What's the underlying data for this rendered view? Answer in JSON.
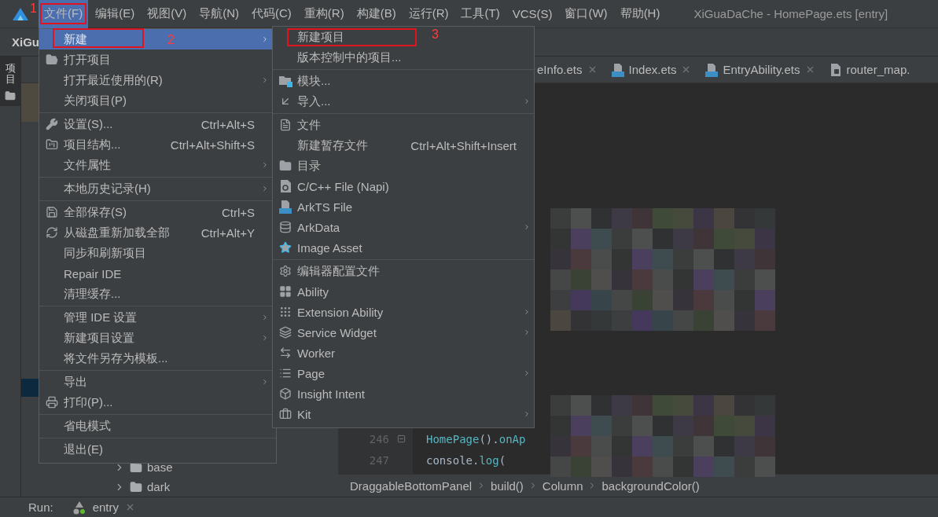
{
  "menubar": {
    "items": [
      {
        "label": "文件(F)",
        "selected": true
      },
      {
        "label": "编辑(E)",
        "selected": false
      },
      {
        "label": "视图(V)",
        "selected": false
      },
      {
        "label": "导航(N)",
        "selected": false
      },
      {
        "label": "代码(C)",
        "selected": false
      },
      {
        "label": "重构(R)",
        "selected": false
      },
      {
        "label": "构建(B)",
        "selected": false
      },
      {
        "label": "运行(R)",
        "selected": false
      },
      {
        "label": "工具(T)",
        "selected": false
      },
      {
        "label": "VCS(S)",
        "selected": false
      },
      {
        "label": "窗口(W)",
        "selected": false
      },
      {
        "label": "帮助(H)",
        "selected": false
      }
    ],
    "title": "XiGuaDaChe - HomePage.ets [entry]"
  },
  "toolbar": {
    "project": "XiGu"
  },
  "tool_strip": {
    "label": "项目",
    "selected": true
  },
  "tabs": [
    {
      "label": "eInfo.ets"
    },
    {
      "label": "Index.ets"
    },
    {
      "label": "EntryAbility.ets"
    },
    {
      "label": "router_map."
    }
  ],
  "project_tree": [
    {
      "label": "base"
    },
    {
      "label": "dark"
    }
  ],
  "editor": {
    "lines": [
      {
        "number": "246",
        "tokens": [
          {
            "text": "HomePage",
            "kind": "fn"
          },
          {
            "text": "().",
            "kind": "plain"
          },
          {
            "text": "onAp",
            "kind": "fn"
          }
        ]
      },
      {
        "number": "247",
        "tokens": [
          {
            "text": "console.",
            "kind": "plain"
          },
          {
            "text": "log",
            "kind": "fn"
          },
          {
            "text": "(",
            "kind": "plain"
          }
        ]
      }
    ]
  },
  "breadcrumb": [
    "DraggableBottomPanel",
    "build()",
    "Column",
    "backgroundColor()"
  ],
  "run_bar": {
    "label": "Run:",
    "config": "entry"
  },
  "file_menu": {
    "groups": [
      [
        {
          "label": "新建",
          "submenu": true,
          "selected": true
        },
        {
          "label": "打开项目",
          "submenu": false,
          "selected": false
        },
        {
          "label": "打开最近使用的(R)",
          "submenu": true,
          "selected": false
        },
        {
          "label": "关闭项目(P)",
          "submenu": false,
          "selected": false
        }
      ],
      [
        {
          "label": "设置(S)...",
          "shortcut": "Ctrl+Alt+S",
          "submenu": false,
          "selected": false
        },
        {
          "label": "项目结构...",
          "shortcut": "Ctrl+Alt+Shift+S",
          "submenu": false,
          "selected": false
        },
        {
          "label": "文件属性",
          "submenu": true,
          "selected": false
        }
      ],
      [
        {
          "label": "本地历史记录(H)",
          "submenu": true,
          "selected": false
        }
      ],
      [
        {
          "label": "全部保存(S)",
          "shortcut": "Ctrl+S",
          "submenu": false,
          "selected": false
        },
        {
          "label": "从磁盘重新加载全部",
          "shortcut": "Ctrl+Alt+Y",
          "submenu": false,
          "selected": false
        },
        {
          "label": "同步和刷新项目",
          "submenu": false,
          "selected": false
        },
        {
          "label": "Repair IDE",
          "submenu": false,
          "selected": false
        },
        {
          "label": "清理缓存...",
          "submenu": false,
          "selected": false
        }
      ],
      [
        {
          "label": "管理 IDE 设置",
          "submenu": true,
          "selected": false
        },
        {
          "label": "新建项目设置",
          "submenu": true,
          "selected": false
        },
        {
          "label": "将文件另存为模板...",
          "submenu": false,
          "selected": false
        }
      ],
      [
        {
          "label": "导出",
          "submenu": true,
          "selected": false
        },
        {
          "label": "打印(P)...",
          "submenu": false,
          "selected": false
        }
      ],
      [
        {
          "label": "省电模式",
          "submenu": false,
          "selected": false
        }
      ],
      [
        {
          "label": "退出(E)",
          "submenu": false,
          "selected": false
        }
      ]
    ]
  },
  "new_submenu": {
    "groups": [
      [
        {
          "label": "新建项目",
          "submenu": false
        },
        {
          "label": "版本控制中的项目...",
          "submenu": false
        }
      ],
      [
        {
          "label": "模块...",
          "submenu": false
        },
        {
          "label": "导入...",
          "submenu": true
        }
      ],
      [
        {
          "label": "文件",
          "submenu": false
        },
        {
          "label": "新建暂存文件",
          "shortcut": "Ctrl+Alt+Shift+Insert",
          "submenu": false
        },
        {
          "label": "目录",
          "submenu": false
        },
        {
          "label": "C/C++ File (Napi)",
          "submenu": false
        },
        {
          "label": "ArkTS File",
          "submenu": false
        },
        {
          "label": "ArkData",
          "submenu": true
        },
        {
          "label": "Image Asset",
          "submenu": false
        }
      ],
      [
        {
          "label": "编辑器配置文件",
          "submenu": false
        },
        {
          "label": "Ability",
          "submenu": false
        },
        {
          "label": "Extension Ability",
          "submenu": true
        },
        {
          "label": "Service Widget",
          "submenu": true
        },
        {
          "label": "Worker",
          "submenu": false
        },
        {
          "label": "Page",
          "submenu": true
        },
        {
          "label": "Insight Intent",
          "submenu": false
        },
        {
          "label": "Kit",
          "submenu": true
        }
      ]
    ]
  },
  "annotations": [
    {
      "label": "1"
    },
    {
      "label": "2"
    },
    {
      "label": "3"
    }
  ]
}
